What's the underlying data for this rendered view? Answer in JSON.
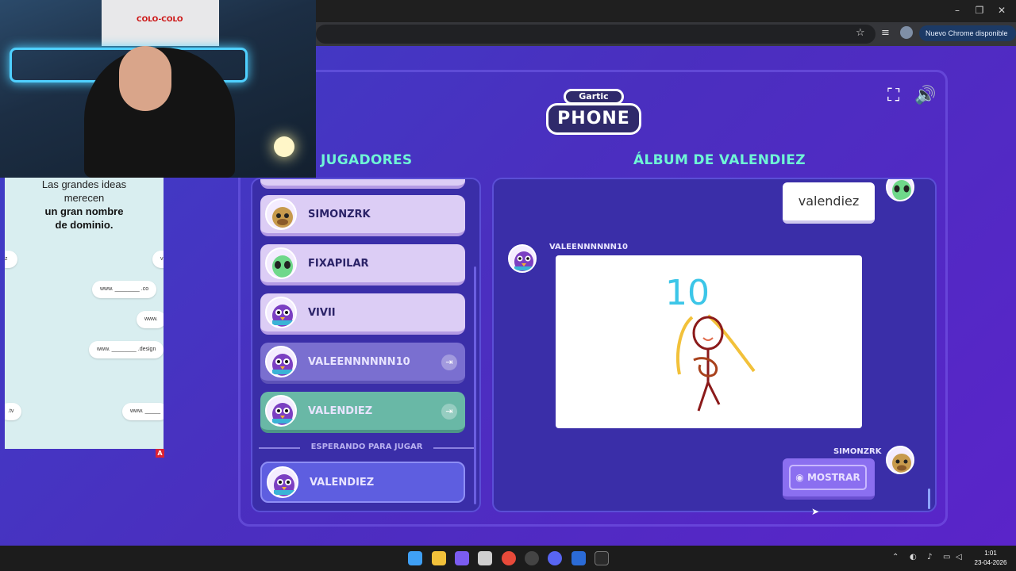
{
  "browser": {
    "update_label": "Nuevo Chrome disponible"
  },
  "game": {
    "players_title": "JUGADORES",
    "album_title": "ÁLBUM DE VALENDIEZ",
    "logo_top": "Gartic",
    "logo_bottom": "PHONE",
    "players": [
      {
        "name": "SIMONZRK",
        "avatar": "bull-avatar-icon",
        "state": "normal"
      },
      {
        "name": "FIXAPILAR",
        "avatar": "alien-avatar-icon",
        "state": "normal"
      },
      {
        "name": "VIVII",
        "avatar": "bird-avatar-icon",
        "state": "normal"
      },
      {
        "name": "VALEENNNNNN10",
        "avatar": "bird-avatar-icon",
        "state": "dim"
      },
      {
        "name": "VALENDIEZ",
        "avatar": "bird-avatar-icon",
        "state": "teal"
      }
    ],
    "waiting_label": "ESPERANDO PARA JUGAR",
    "waiting_players": [
      {
        "name": "VALENDIEZ",
        "avatar": "bird-avatar-icon"
      }
    ],
    "album": {
      "first_phrase": "valendiez",
      "drawer_name": "VALEENNNNNN10",
      "drawing_text": "10",
      "next_player": "SIMONZRK",
      "show_button": "MOSTRAR"
    }
  },
  "ad": {
    "line1": "Las grandes ideas",
    "line2": "merecen",
    "line3": "un gran nombre",
    "line4": "de dominio.",
    "pills": [
      "www. ________ .co",
      "www.",
      "www. ________ .design",
      ".tv",
      "www. _____"
    ],
    "badge": "A"
  },
  "webcam": {
    "flag_text": "COLO-COLO"
  },
  "taskbar": {
    "time": "1:01",
    "date": "23-04-2026"
  },
  "colors": {
    "accent_teal": "#6ff5d6",
    "game_bg": "#4a2fbf",
    "panel_bg": "#3a2ea8"
  }
}
